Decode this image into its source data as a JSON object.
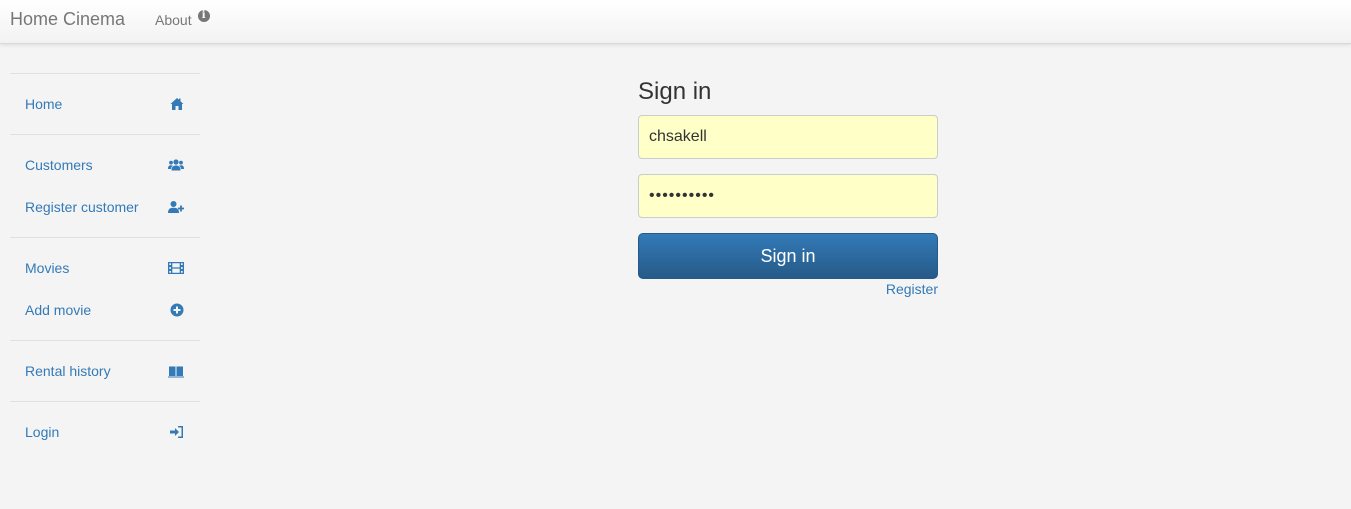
{
  "navbar": {
    "brand": "Home Cinema",
    "about_label": "About",
    "about_icon": "info-circle-icon"
  },
  "sidebar": {
    "groups": [
      [
        {
          "label": "Home",
          "icon": "home-icon"
        }
      ],
      [
        {
          "label": "Customers",
          "icon": "users-icon"
        },
        {
          "label": "Register customer",
          "icon": "user-plus-icon"
        }
      ],
      [
        {
          "label": "Movies",
          "icon": "film-icon"
        },
        {
          "label": "Add movie",
          "icon": "plus-circle-icon"
        }
      ],
      [
        {
          "label": "Rental history",
          "icon": "book-icon"
        }
      ],
      [
        {
          "label": "Login",
          "icon": "sign-in-icon"
        }
      ]
    ]
  },
  "signin": {
    "title": "Sign in",
    "username_value": "chsakell",
    "password_value": "••••••••••",
    "button_label": "Sign in",
    "register_link": "Register"
  },
  "colors": {
    "link": "#337ab7",
    "button": "#2d6ca2",
    "field_bg": "#ffffc8",
    "page_bg": "#f4f4f4"
  }
}
